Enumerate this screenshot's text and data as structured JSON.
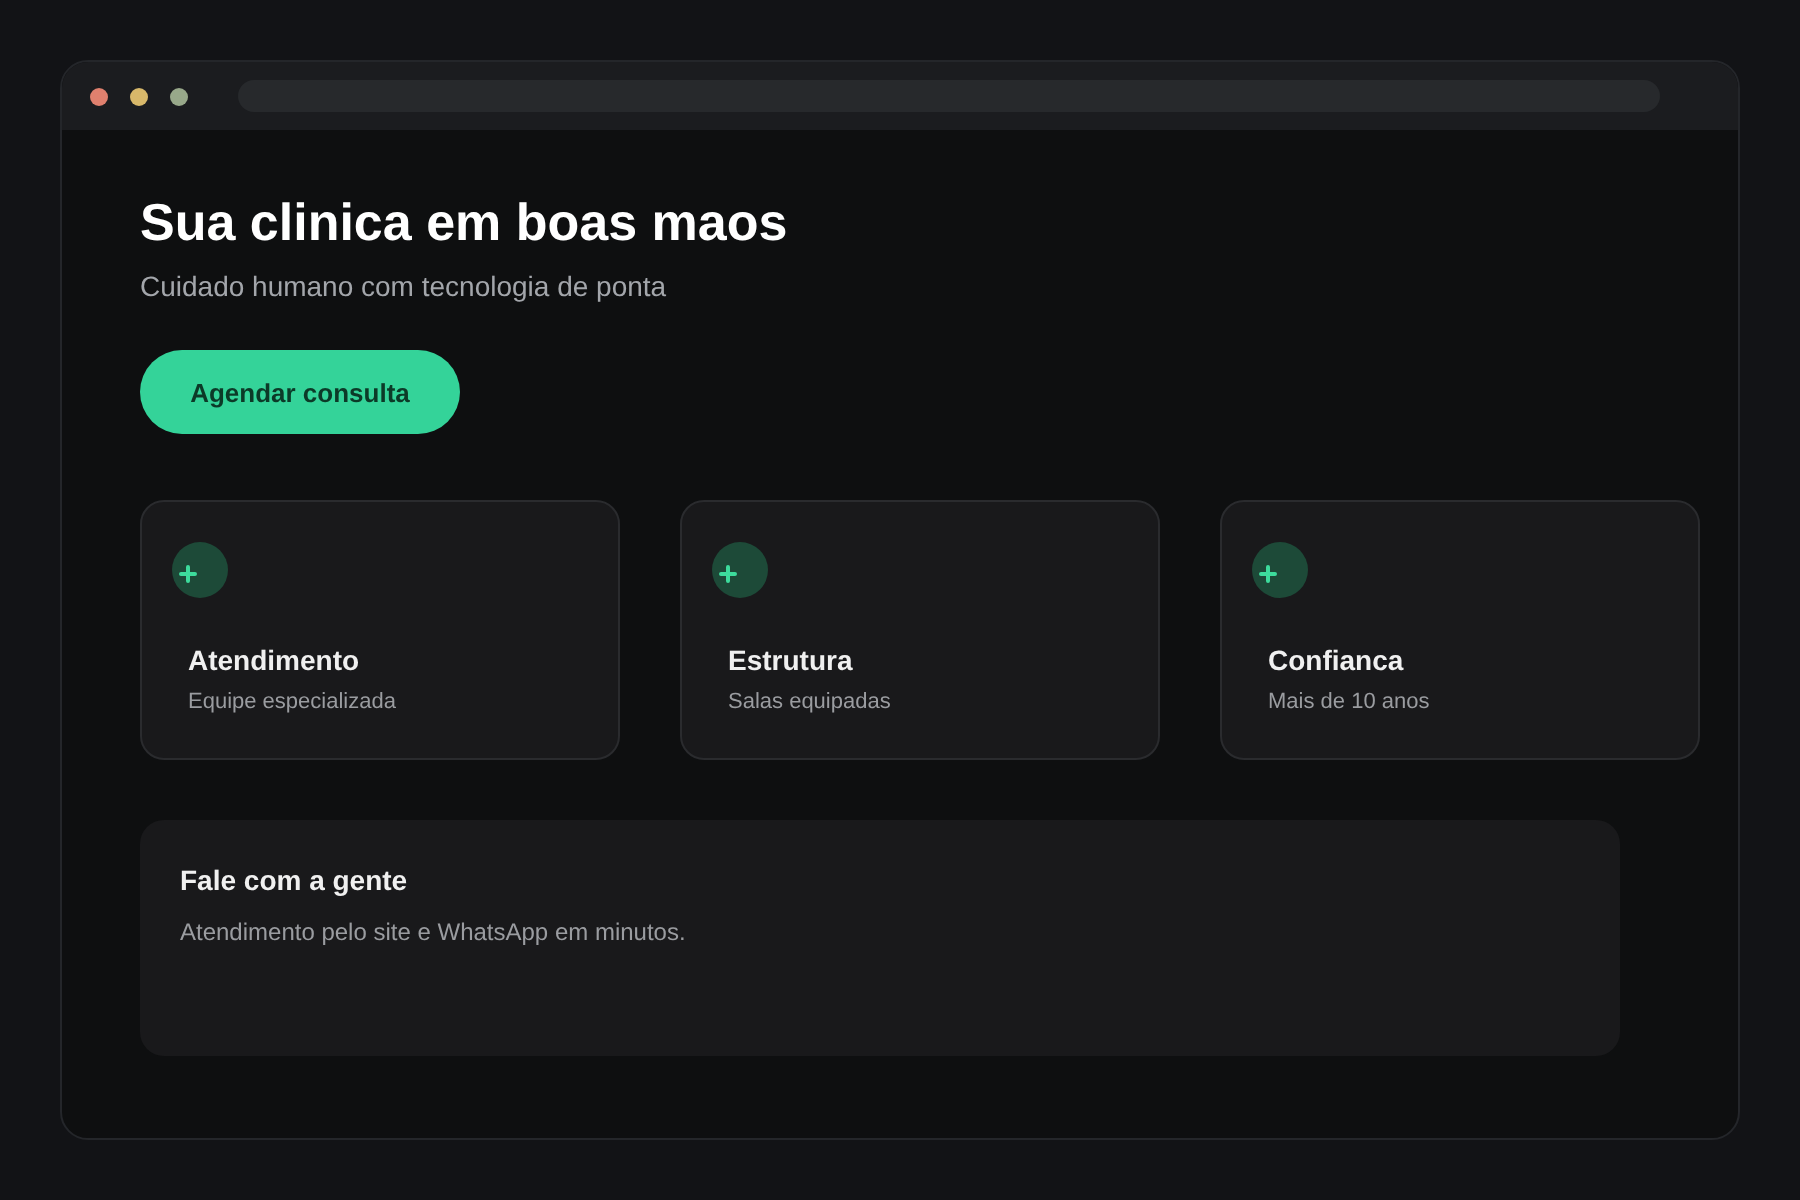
{
  "hero": {
    "title": "Sua clinica em boas maos",
    "subtitle": "Cuidado humano com tecnologia de ponta",
    "button": "Agendar consulta"
  },
  "features": [
    {
      "title": "Atendimento",
      "description": "Equipe especializada"
    },
    {
      "title": "Estrutura",
      "description": "Salas equipadas"
    },
    {
      "title": "Confianca",
      "description": "Mais de 10 anos"
    }
  ],
  "contact": {
    "title": "Fale com a gente",
    "text": "Atendimento pelo site e WhatsApp em minutos."
  }
}
